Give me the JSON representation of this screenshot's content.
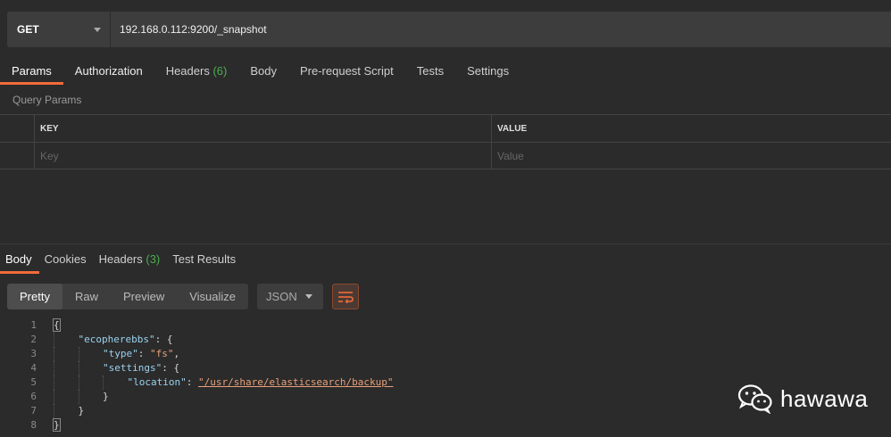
{
  "request": {
    "method": "GET",
    "url": "192.168.0.112:9200/_snapshot"
  },
  "request_tabs": [
    {
      "label": "Params",
      "count": ""
    },
    {
      "label": "Authorization",
      "count": ""
    },
    {
      "label": "Headers",
      "count": "(6)"
    },
    {
      "label": "Body",
      "count": ""
    },
    {
      "label": "Pre-request Script",
      "count": ""
    },
    {
      "label": "Tests",
      "count": ""
    },
    {
      "label": "Settings",
      "count": ""
    }
  ],
  "query_params": {
    "title": "Query Params",
    "key_header": "KEY",
    "value_header": "VALUE",
    "key_placeholder": "Key",
    "value_placeholder": "Value"
  },
  "response_tabs": [
    {
      "label": "Body",
      "count": ""
    },
    {
      "label": "Cookies",
      "count": ""
    },
    {
      "label": "Headers",
      "count": "(3)"
    },
    {
      "label": "Test Results",
      "count": ""
    }
  ],
  "view_modes": [
    "Pretty",
    "Raw",
    "Preview",
    "Visualize"
  ],
  "format": "JSON",
  "code_lines": [
    "1",
    "2",
    "3",
    "4",
    "5",
    "6",
    "7",
    "8"
  ],
  "code": {
    "l1": "{",
    "l2_key": "\"ecopherebbs\"",
    "l2_rest": ": {",
    "l3_key": "\"type\"",
    "l3_sep": ": ",
    "l3_val": "\"fs\"",
    "l3_end": ",",
    "l4_key": "\"settings\"",
    "l4_rest": ": {",
    "l5_key": "\"location\"",
    "l5_sep": ": ",
    "l5_val": "\"/usr/share/elasticsearch/backup\"",
    "l6": "}",
    "l7": "}",
    "l8": "}"
  },
  "watermark": "hawawa",
  "colors": {
    "accent": "#f26b3a",
    "count": "#4caf50",
    "json_key": "#9ad2f0",
    "json_string": "#e8a07a"
  }
}
